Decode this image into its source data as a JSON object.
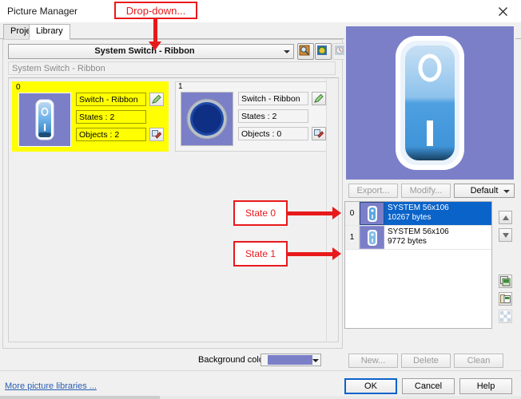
{
  "window": {
    "title": "Picture Manager",
    "close_icon": "close-icon"
  },
  "tabs": [
    {
      "label": "Project",
      "selected": false
    },
    {
      "label": "Library",
      "selected": true
    }
  ],
  "library": {
    "dropdown_value": "System Switch - Ribbon",
    "subtitle": "System Switch - Ribbon",
    "toolbar": [
      {
        "icon": "search-preview-icon"
      },
      {
        "icon": "refresh-library-icon"
      },
      {
        "icon": "history-library-icon"
      }
    ],
    "cards": [
      {
        "index": "0",
        "name_label": "Switch - Ribbon",
        "states_label": "States : 2",
        "objects_label": "Objects : 2",
        "edit_icon": "pencil-icon",
        "objects_icon": "objects-icon",
        "selected": true,
        "thumb": "switch-ribbon-thumb"
      },
      {
        "index": "1",
        "name_label": "Switch - Ribbon",
        "states_label": "States : 2",
        "objects_label": "Objects : 0",
        "edit_icon": "pencil-icon",
        "objects_icon": "objects-icon",
        "selected": false,
        "thumb": "round-button-thumb"
      }
    ]
  },
  "preview": {
    "image_name": "system-switch-ribbon-preview",
    "background_color": "#7b7fc8",
    "label_top": "O",
    "label_bottom": "I"
  },
  "image_buttons": {
    "export_label": "Export...",
    "modify_label": "Modify...",
    "default_label": "Default"
  },
  "state_list": {
    "rows": [
      {
        "index": "0",
        "title": "SYSTEM 56x106",
        "size": "10267 bytes",
        "selected": true,
        "thumb": "switch-state0-thumb"
      },
      {
        "index": "1",
        "title": "SYSTEM 56x106",
        "size": "9772 bytes",
        "selected": false,
        "thumb": "switch-state1-thumb"
      }
    ],
    "move_up_icon": "arrow-up-icon",
    "move_down_icon": "arrow-down-icon",
    "tool_icons": [
      "copy-image-icon",
      "paste-image-icon",
      "transparency-icon"
    ]
  },
  "bottom": {
    "background_color_label": "Background color :",
    "background_color_value": "#7b7fc8",
    "new_label": "New...",
    "delete_label": "Delete",
    "clean_label": "Clean",
    "more_libraries_label": "More picture libraries ...",
    "ok_label": "OK",
    "cancel_label": "Cancel",
    "help_label": "Help"
  },
  "annotations": {
    "dropdown": "Drop-down...",
    "state0": "State 0",
    "state1": "State 1",
    "color": "#e8191b"
  }
}
